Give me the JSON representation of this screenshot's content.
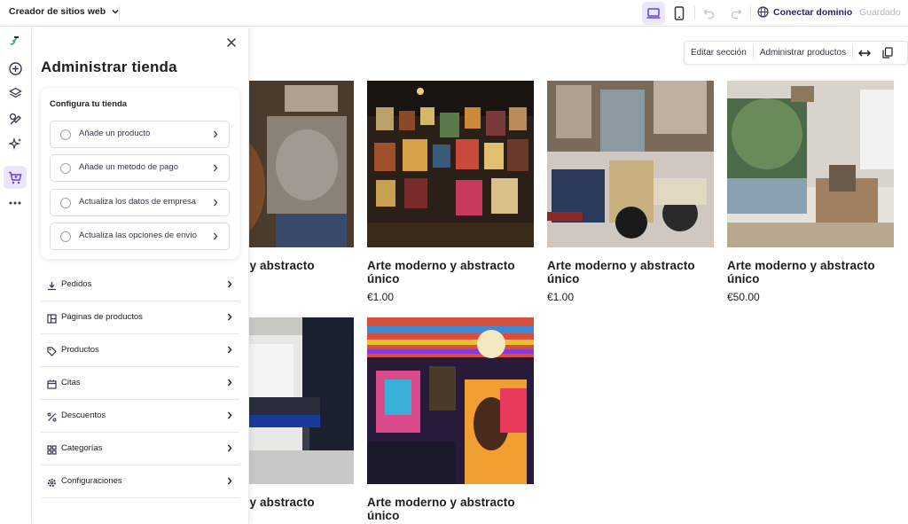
{
  "topbar": {
    "brand_label": "Creador de sitios web",
    "connect_label": "Conectar dominio",
    "saved_label": "Guardado",
    "accent_color": "#673de6"
  },
  "rail": {
    "items": [
      "add-icon",
      "layers-icon",
      "design-icon",
      "ai-sparkle-icon",
      "store-cart-icon",
      "more-icon"
    ],
    "active": "store-cart-icon"
  },
  "toolbar": {
    "edit_section": "Editar sección",
    "manage_products": "Administrar productos"
  },
  "products": [
    {
      "title": "Arte moderno y abstracto único",
      "price": "",
      "visible_title": "no y abstracto"
    },
    {
      "title": "Arte moderno y abstracto único",
      "price": "€1.00"
    },
    {
      "title": "Arte moderno y abstracto único",
      "price": "€1.00"
    },
    {
      "title": "Arte moderno y abstracto único",
      "price": "€50.00"
    },
    {
      "title": "Arte moderno y abstracto único",
      "price": "",
      "visible_title": "no y abstracto"
    },
    {
      "title": "Arte moderno y abstracto único",
      "price": ""
    }
  ],
  "panel": {
    "title": "Administrar tienda",
    "setup_title": "Configura tu tienda",
    "setup_items": [
      "Añade un producto",
      "Añade un metodo de pago",
      "Actualiza los datos de empresa",
      "Actualiza las opciones de envío"
    ],
    "menu_items": [
      {
        "label": "Pedidos",
        "icon": "download-icon"
      },
      {
        "label": "Páginas de productos",
        "icon": "layout-icon"
      },
      {
        "label": "Productos",
        "icon": "tag-icon"
      },
      {
        "label": "Citas",
        "icon": "calendar-icon"
      },
      {
        "label": "Descuentos",
        "icon": "percent-icon"
      },
      {
        "label": "Categorías",
        "icon": "grid-icon"
      },
      {
        "label": "Configuraciones",
        "icon": "settings-gear-icon"
      }
    ]
  }
}
